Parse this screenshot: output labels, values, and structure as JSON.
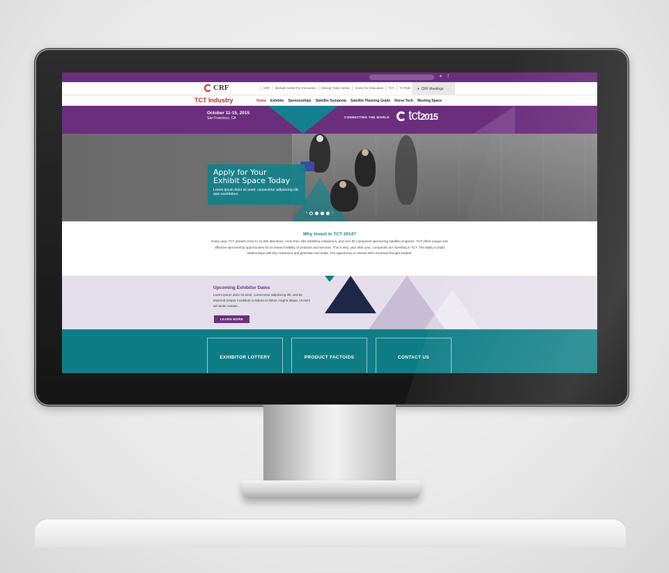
{
  "top_bar": {
    "twitter_icon": "twitter-icon",
    "facebook_icon": "facebook-icon"
  },
  "crf_bar": {
    "logo_text": "CRF",
    "links": [
      "CRF",
      "Skirball Center For Innovation",
      "Clinical Trials Center",
      "Center for Education",
      "TCT",
      "TCTMD"
    ],
    "meetings_label": "CRF Meetings"
  },
  "nav": {
    "title": "TCT Industry",
    "items": [
      "Home",
      "Exhibits",
      "Sponsorships",
      "Satellite Symposia",
      "Satellite Planning Guide",
      "Nurse Tech",
      "Meeting Space"
    ],
    "active": "Home"
  },
  "banner": {
    "date": "October 11-15, 2015",
    "location": "San Francisco, CA",
    "tagline": "CONNECTING THE WORLD",
    "logo_word": "tct",
    "logo_year": "2015"
  },
  "hero": {
    "heading_line1": "Apply for Your",
    "heading_line2": "Exhibit Space Today",
    "body": "Lorem ipsum dolor sit amet, consectetur adipisicing elit, quis nostrdolore.",
    "slide_count": 4,
    "active_slide": 1
  },
  "why": {
    "heading": "Why Invest in TCT 2014?",
    "body": "Every year, TCT attracts close to 12,000 attendees, more than 150 exhibiting companies, and over 50 companies sponsoring satellite programs. TCT offers unique and effective sponsorship opportunities for increased visibility of products and services. This is why, year after year, companies are investing in TCT. The ability to build relationships with key customers and generate new leads. The opportunity to interact with renowned thought leaders."
  },
  "upcoming": {
    "heading": "Upcoming Exhibitor Dates",
    "body": "Lorem ipsum dolor sit amet, consectetur adipisicing elit, sed do eiusmod tempor incididunt ut labore et dolore magna aliqua. Ut enim ad minim veniam.",
    "button": "LEARN MORE"
  },
  "cta": {
    "items": [
      "EXHIBITOR LOTTERY",
      "PRODUCT FACTOIDS",
      "CONTACT US"
    ]
  },
  "colors": {
    "purple": "#6b2e7d",
    "teal": "#0e7d86",
    "red": "#c0262d",
    "lavender": "#e4dfea"
  }
}
